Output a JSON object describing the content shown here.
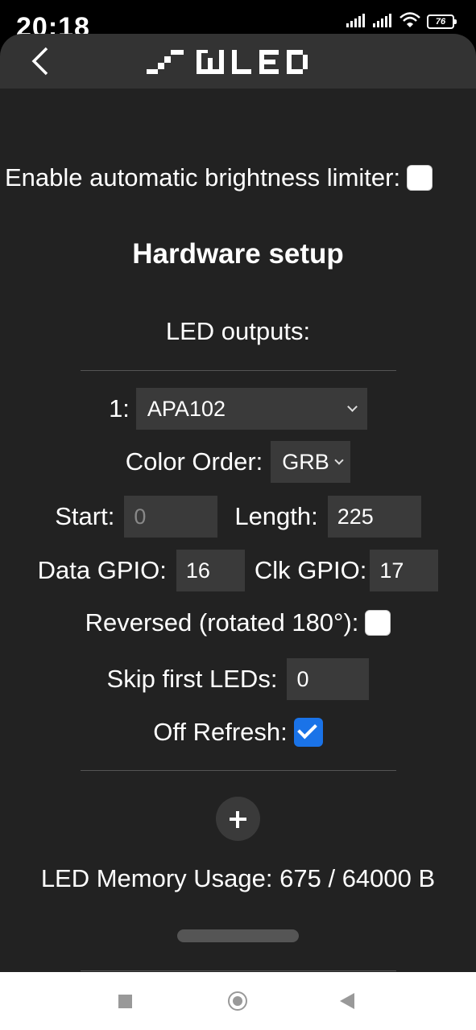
{
  "status": {
    "time": "20:18",
    "battery": "76"
  },
  "brand": "WLED",
  "abl": {
    "label": "Enable automatic brightness limiter:",
    "checked": false
  },
  "section_title": "Hardware setup",
  "outputs_label": "LED outputs:",
  "output1": {
    "index_label": "1:",
    "type": "APA102",
    "color_order_label": "Color Order:",
    "color_order": "GRB",
    "start_label": "Start:",
    "start_value": "0",
    "length_label": "Length:",
    "length_value": "225",
    "data_gpio_label": "Data GPIO:",
    "data_gpio_value": "16",
    "clk_gpio_label": "Clk GPIO:",
    "clk_gpio_value": "17",
    "reversed_label": "Reversed (rotated 180°):",
    "reversed_checked": false,
    "skip_label": "Skip first LEDs:",
    "skip_value": "0",
    "off_refresh_label": "Off Refresh:",
    "off_refresh_checked": true
  },
  "memory_usage": "LED Memory Usage: 675 / 64000 B",
  "colors": {
    "accent": "#1a73e8",
    "background": "#222222",
    "appbar": "#333333"
  }
}
